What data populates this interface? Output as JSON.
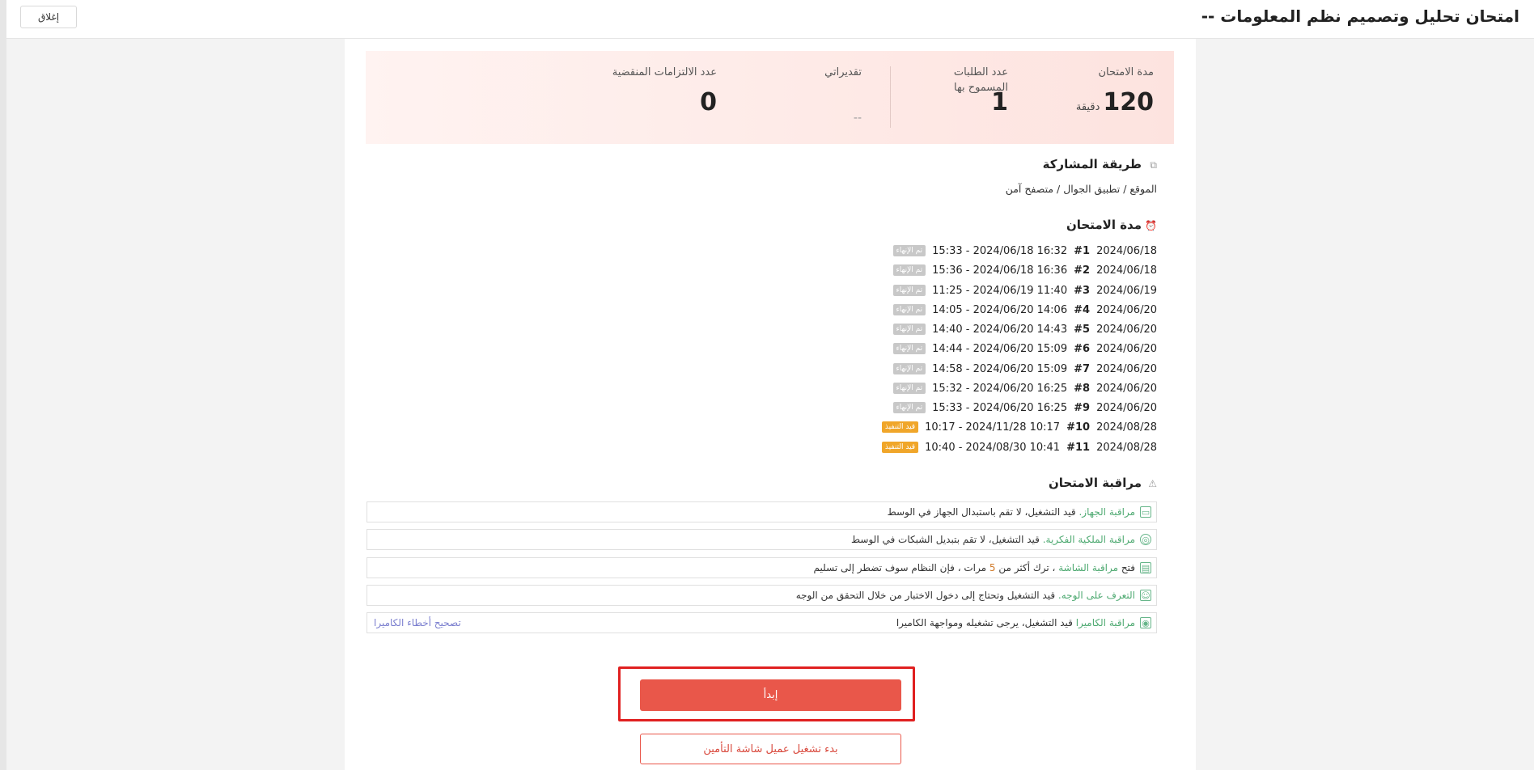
{
  "header": {
    "title": "امتحان تحليل وتصميم نظم المعلومات --",
    "close_label": "إغلاق"
  },
  "stats": {
    "duration_label": "مدة الامتحان",
    "duration_value": "120",
    "duration_unit": "دقيقة",
    "allowed_label": "عدد الطلبات المسموح بها",
    "allowed_value": "1",
    "grades_label": "تقديراتي",
    "grades_value": "--",
    "expired_label": "عدد الالتزامات المنقضية",
    "expired_value": "0"
  },
  "participation": {
    "title": "طريقة المشاركة",
    "value": "الموقع / تطبيق الجوال / متصفح آمن"
  },
  "sessions": {
    "title": "مدة الامتحان",
    "items": [
      {
        "num": "#1",
        "date": "2024/06/18",
        "range": "15:33 - 2024/06/18 16:32",
        "status": "تم الإنهاء",
        "state": "done"
      },
      {
        "num": "#2",
        "date": "2024/06/18",
        "range": "15:36 - 2024/06/18 16:36",
        "status": "تم الإنهاء",
        "state": "done"
      },
      {
        "num": "#3",
        "date": "2024/06/19",
        "range": "11:25 - 2024/06/19 11:40",
        "status": "تم الإنهاء",
        "state": "done"
      },
      {
        "num": "#4",
        "date": "2024/06/20",
        "range": "14:05 - 2024/06/20 14:06",
        "status": "تم الإنهاء",
        "state": "done"
      },
      {
        "num": "#5",
        "date": "2024/06/20",
        "range": "14:40 - 2024/06/20 14:43",
        "status": "تم الإنهاء",
        "state": "done"
      },
      {
        "num": "#6",
        "date": "2024/06/20",
        "range": "14:44 - 2024/06/20 15:09",
        "status": "تم الإنهاء",
        "state": "done"
      },
      {
        "num": "#7",
        "date": "2024/06/20",
        "range": "14:58 - 2024/06/20 15:09",
        "status": "تم الإنهاء",
        "state": "done"
      },
      {
        "num": "#8",
        "date": "2024/06/20",
        "range": "15:32 - 2024/06/20 16:25",
        "status": "تم الإنهاء",
        "state": "done"
      },
      {
        "num": "#9",
        "date": "2024/06/20",
        "range": "15:33 - 2024/06/20 16:25",
        "status": "تم الإنهاء",
        "state": "done"
      },
      {
        "num": "#10",
        "date": "2024/08/28",
        "range": "10:17 - 2024/11/28 10:17",
        "status": "قيد التنفيذ",
        "state": "running"
      },
      {
        "num": "#11",
        "date": "2024/08/28",
        "range": "10:40 - 2024/08/30 10:41",
        "status": "قيد التنفيذ",
        "state": "running"
      }
    ]
  },
  "monitoring": {
    "title": "مراقبة الامتحان",
    "device": {
      "name": "مراقبة الجهاز.",
      "text": "قيد التشغيل، لا تقم باستبدال الجهاز في الوسط"
    },
    "ip": {
      "name": "مراقبة الملكية الفكرية.",
      "text": "قيد التشغيل، لا تقم بتبديل الشبكات في الوسط"
    },
    "screen": {
      "prefix": "فتح",
      "name": "مراقبة الشاشة",
      "text1": "، ترك أكثر من",
      "count": "5",
      "text2": "مرات ، فإن النظام سوف تضطر إلى تسليم"
    },
    "face": {
      "name": "التعرف على الوجه.",
      "text": "قيد التشغيل وتحتاج إلى دخول الاختبار من خلال التحقق من الوجه"
    },
    "camera": {
      "name": "مراقبة الكاميرا",
      "text": "قيد التشغيل، يرجى تشغيله ومواجهة الكاميرا",
      "fix_link": "تصحيح أخطاء الكاميرا"
    }
  },
  "actions": {
    "start_label": "إبدأ",
    "client_label": "بدء تشغيل عميل شاشة التأمين"
  },
  "colors": {
    "accent": "#e9574a",
    "monitor_green": "#4faa72",
    "badge_done": "#c8c8c8",
    "badge_running": "#f0a62a",
    "link": "#7b7fcf"
  }
}
